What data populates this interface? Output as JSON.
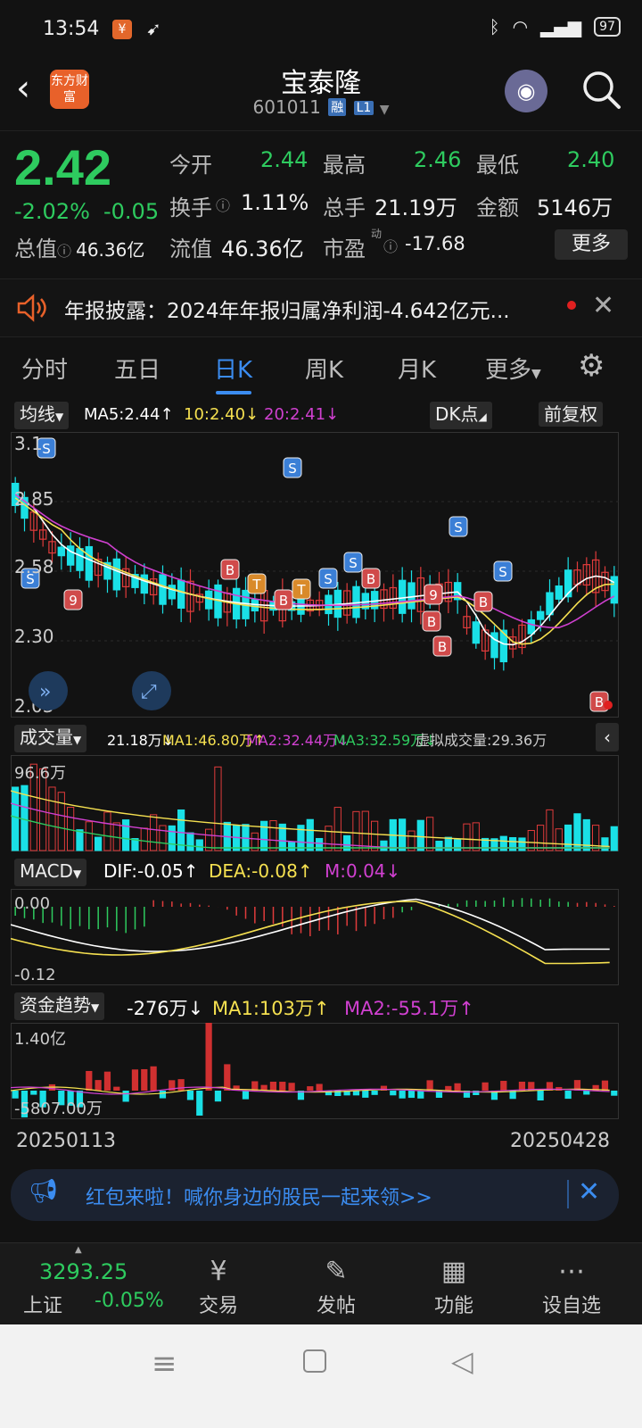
{
  "status": {
    "time": "13:54",
    "battery": "97"
  },
  "header": {
    "logo": "东方财富",
    "title": "宝泰隆",
    "code": "601011",
    "tag_margin": "融",
    "tag_level": "L1"
  },
  "quote": {
    "price": "2.42",
    "change_pct": "-2.02%",
    "change": "-0.05",
    "open_label": "今开",
    "open": "2.44",
    "high_label": "最高",
    "high": "2.46",
    "low_label": "最低",
    "low": "2.40",
    "turnover_label": "换手",
    "turnover": "1.11%",
    "volume_label": "总手",
    "volume": "21.19万",
    "amount_label": "金额",
    "amount": "5146万",
    "mktcap_label": "总值",
    "mktcap": "46.36亿",
    "float_label": "流值",
    "float": "46.36亿",
    "pe_label": "市盈",
    "pe_sup": "动",
    "pe": "-17.68",
    "more": "更多"
  },
  "news": {
    "text": "年报披露：2024年年报归属净利润-4.642亿元..."
  },
  "tabs": [
    "分时",
    "五日",
    "日K",
    "周K",
    "月K",
    "更多"
  ],
  "kline": {
    "ma_chip": "均线",
    "ma5": "MA5:2.44↑",
    "ma10": "10:2.40↓",
    "ma20": "20:2.41↓",
    "dk_chip": "DK点",
    "adj_chip": "前复权",
    "axis": [
      "3.1",
      "2.85",
      "2.58",
      "2.30",
      "2.03"
    ]
  },
  "volume": {
    "chip": "成交量",
    "v": "21.18万↓",
    "ma1": "MA1:46.80万↑",
    "ma2": "MA2:32.44万↓",
    "ma3": "MA3:32.59万↓",
    "virtual": "虚拟成交量:29.36万",
    "axis_top": "96.6万"
  },
  "macd": {
    "chip": "MACD",
    "dif": "DIF:-0.05↑",
    "dea": "DEA:-0.08↑",
    "m": "M:0.04↓",
    "axis_top": "0.00",
    "axis_bottom": "-0.12"
  },
  "fund": {
    "chip": "资金趋势",
    "v": "-276万↓",
    "ma1": "MA1:103万↑",
    "ma2": "MA2:-55.1万↑",
    "axis_top": "1.40亿",
    "axis_bottom": "-5807.00万"
  },
  "dates": {
    "start": "20250113",
    "end": "20250428"
  },
  "banner": {
    "text": "红包来啦！喊你身边的股民一起来领>>"
  },
  "bottom": {
    "index_value": "3293.25",
    "index_name": "上证",
    "index_pct": "-0.05%",
    "trade": "交易",
    "post": "发帖",
    "func": "功能",
    "watch": "设自选"
  },
  "colors": {
    "up": "#e03b3b",
    "down": "#1ae0e6",
    "ma5": "#ffffff",
    "ma10": "#f5e050",
    "ma20": "#d040d0",
    "green": "#2ecb5f",
    "accent": "#3b8cf0"
  }
}
